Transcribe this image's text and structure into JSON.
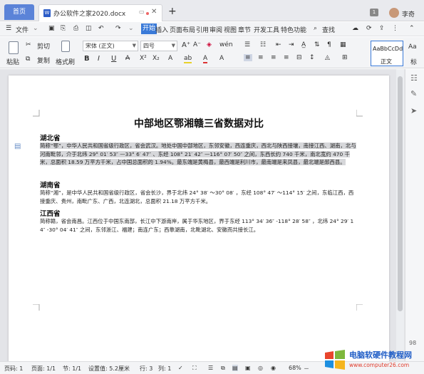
{
  "tabs": {
    "home": "首页",
    "doc": "办公软件之家2020.docx",
    "badge": "1",
    "user": "李奇"
  },
  "menu": {
    "file": "文件",
    "items": [
      "开始",
      "插入",
      "页面布局",
      "引用",
      "审阅",
      "视图",
      "章节",
      "开发工具",
      "特色功能"
    ],
    "search": "查找"
  },
  "ribbon": {
    "paste": "粘贴",
    "cut": "剪切",
    "copy": "复制",
    "format_painter": "格式刷",
    "font": "宋体 (正文)",
    "size": "四号",
    "bold": "B",
    "italic": "I",
    "underline": "U",
    "style1": "AaBbCcDd",
    "style_normal": "正文",
    "style_more": "标"
  },
  "doc": {
    "title": "中部地区鄂湘赣三省数据对比",
    "h1": "湖北省",
    "p1": "简称“鄂”，中华人民共和国省级行政区，省会武汉。地处中国中部地区，东邻安徽，西连重庆，西北与陕西接壤，南接江西、湖南，北与河南毗邻，介于北纬 29° 01′ 53″ —33° 6′ 47″ 、东经 108° 21′ 42″ —116° 07′ 50″ 之间，东西长约 740 千米，南北宽约 470 千米，总面积 18.59 万平方千米，占中国总面积的 1.94%。最东端是黄梅县，最西端是利川市，最南端是来凤县，最北端是郧西县。",
    "h2": "湖南省",
    "p2": "简称“湘”，是中华人民共和国省级行政区，省会长沙，界于北纬 24° 38′ ～30° 08′ ，东经 108° 47′ ～114° 15′ 之间，东临江西，西接重庆、贵州，南毗广东、广西，北连湖北，总面积 21.18 万平方千米。",
    "h3": "江西省",
    "p3": "简称赣，省会南昌。江西位于中国东南部，长江中下游南岸，属于华东地区，界于东经 113° 34′ 36″ -118° 28′ 58″ ，北纬 24° 29′ 14″ -30° 04′ 41″ 之间，东邻浙江、福建；南连广东；西靠湖南，北毗湖北、安徽而共接长江。"
  },
  "status": {
    "page_code": "页码: 1",
    "page": "页面: 1/1",
    "section": "节: 1/1",
    "setting": "设置值: 5.2厘米",
    "row": "行: 3",
    "col": "列: 1",
    "zoom": "68%",
    "right_num": "98"
  },
  "watermark": {
    "text": "电脑软硬件教程网",
    "url": "www.computer26.com"
  }
}
